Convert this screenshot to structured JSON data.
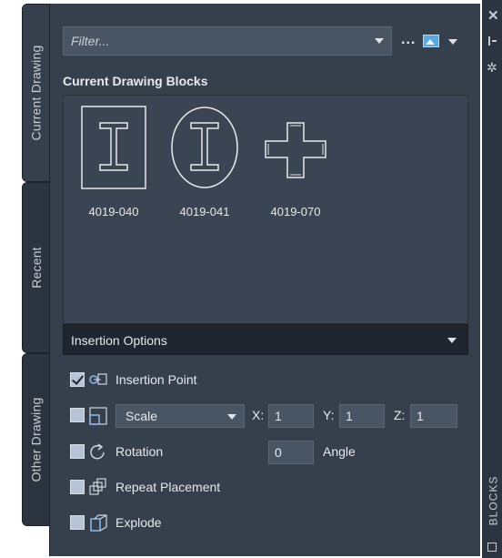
{
  "side_tabs": [
    {
      "label": "Current Drawing",
      "active": true
    },
    {
      "label": "Recent",
      "active": false
    },
    {
      "label": "Other Drawing",
      "active": false
    }
  ],
  "toolbar": {
    "filter_placeholder": "Filter...",
    "more_label": "...",
    "view_icon": "image-view-icon"
  },
  "current_blocks": {
    "title": "Current Drawing Blocks",
    "items": [
      {
        "name": "4019-040",
        "icon": "i-beam-square-block"
      },
      {
        "name": "4019-041",
        "icon": "i-beam-circle-block"
      },
      {
        "name": "4019-070",
        "icon": "cross-block"
      }
    ]
  },
  "insertion": {
    "title": "Insertion Options",
    "insertion_point": {
      "label": "Insertion Point",
      "checked": true
    },
    "scale": {
      "checked": false,
      "mode": "Scale",
      "x_label": "X:",
      "x": "1",
      "y_label": "Y:",
      "y": "1",
      "z_label": "Z:",
      "z": "1"
    },
    "rotation": {
      "label": "Rotation",
      "checked": false,
      "value": "0",
      "unit_label": "Angle"
    },
    "repeat": {
      "label": "Repeat Placement",
      "checked": false
    },
    "explode": {
      "label": "Explode",
      "checked": false
    }
  },
  "palette": {
    "title": "BLOCKS",
    "close_icon": "close-icon",
    "pin_icon": "auto-hide-icon",
    "properties_icon": "properties-icon"
  },
  "colors": {
    "panel_bg": "#36404d",
    "header_bg": "#20262f",
    "field_bg": "#4a5564",
    "text": "#e6e9ee"
  }
}
